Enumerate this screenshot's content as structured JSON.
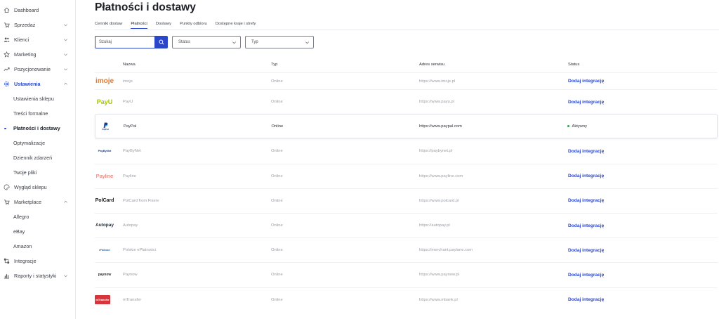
{
  "sidebar": {
    "items": [
      {
        "label": "Dashboard",
        "icon": "home-icon"
      },
      {
        "label": "Sprzedaż",
        "icon": "cart-icon",
        "chevron": "down"
      },
      {
        "label": "Klienci",
        "icon": "users-icon",
        "chevron": "down"
      },
      {
        "label": "Marketing",
        "icon": "star-icon",
        "chevron": "down"
      },
      {
        "label": "Pozycjonowanie",
        "icon": "trend-icon",
        "chevron": "down"
      },
      {
        "label": "Ustawienia",
        "icon": "gear-icon",
        "chevron": "up"
      }
    ],
    "settings_sub": [
      "Ustawienia sklepu",
      "Treści formalne",
      "Płatności i dostawy",
      "Optymalizacje",
      "Dziennik zdarzeń",
      "Twoje pliki"
    ],
    "items2": [
      {
        "label": "Wygląd sklepu",
        "icon": "palette-icon"
      },
      {
        "label": "Marketplace",
        "icon": "marketplace-icon",
        "chevron": "up"
      }
    ],
    "marketplace_sub": [
      "Allegro",
      "eBay",
      "Amazon"
    ],
    "items3": [
      {
        "label": "Integracje",
        "icon": "integrations-icon"
      },
      {
        "label": "Raporty i statystyki",
        "icon": "chart-icon",
        "chevron": "down"
      }
    ]
  },
  "page": {
    "title": "Płatności i dostawy"
  },
  "tabs": [
    "Cenniki dostaw",
    "Płatności",
    "Dostawy",
    "Punkty odbioru",
    "Dostępne kraje i strefy"
  ],
  "filters": {
    "search_placeholder": "Szukaj",
    "status_label": "Status",
    "type_label": "Typ"
  },
  "table": {
    "headers": {
      "name": "Nazwa",
      "type": "Typ",
      "address": "Adres serwisu",
      "status": "Status"
    },
    "rows": [
      {
        "logo": "imoje",
        "name": "imoje",
        "type": "Online",
        "address": "https://www.imoje.pl",
        "status": "Dodaj integrację"
      },
      {
        "logo": "PayU",
        "name": "PayU",
        "type": "Online",
        "address": "https://www.payu.pl",
        "status": "Dodaj integrację"
      },
      {
        "logo": "PayPal",
        "name": "PayPal",
        "type": "Online",
        "address": "https://www.paypal.com",
        "status": "Aktywny"
      },
      {
        "logo": "PayByNet",
        "name": "PayByNet",
        "type": "Online",
        "address": "https://paybynet.pl",
        "status": "Dodaj integrację"
      },
      {
        "logo": "Payline",
        "name": "Payline",
        "type": "Online",
        "address": "https://www.payline.com",
        "status": "Dodaj integrację"
      },
      {
        "logo": "PolCard",
        "name": "PolCard from Fiserv",
        "type": "Online",
        "address": "https://www.polcard.pl",
        "status": "Dodaj integrację"
      },
      {
        "logo": "Autopay",
        "name": "Autopay",
        "type": "Online",
        "address": "https://autopay.pl",
        "status": "Dodaj integrację"
      },
      {
        "logo": "ePlatnosci",
        "name": "Polskie ePłatności",
        "type": "Online",
        "address": "https://merchant.paylane.com",
        "status": "Dodaj integrację"
      },
      {
        "logo": "paynow",
        "name": "Paynow",
        "type": "Online",
        "address": "https://www.paynow.pl",
        "status": "Dodaj integrację"
      },
      {
        "logo": "mTransfer",
        "name": "mTransfer",
        "type": "Online",
        "address": "https://www.mbank.pl",
        "status": "Dodaj integrację"
      }
    ]
  },
  "colors": {
    "accent": "#2b47c9",
    "active_status": "#2da44e"
  }
}
